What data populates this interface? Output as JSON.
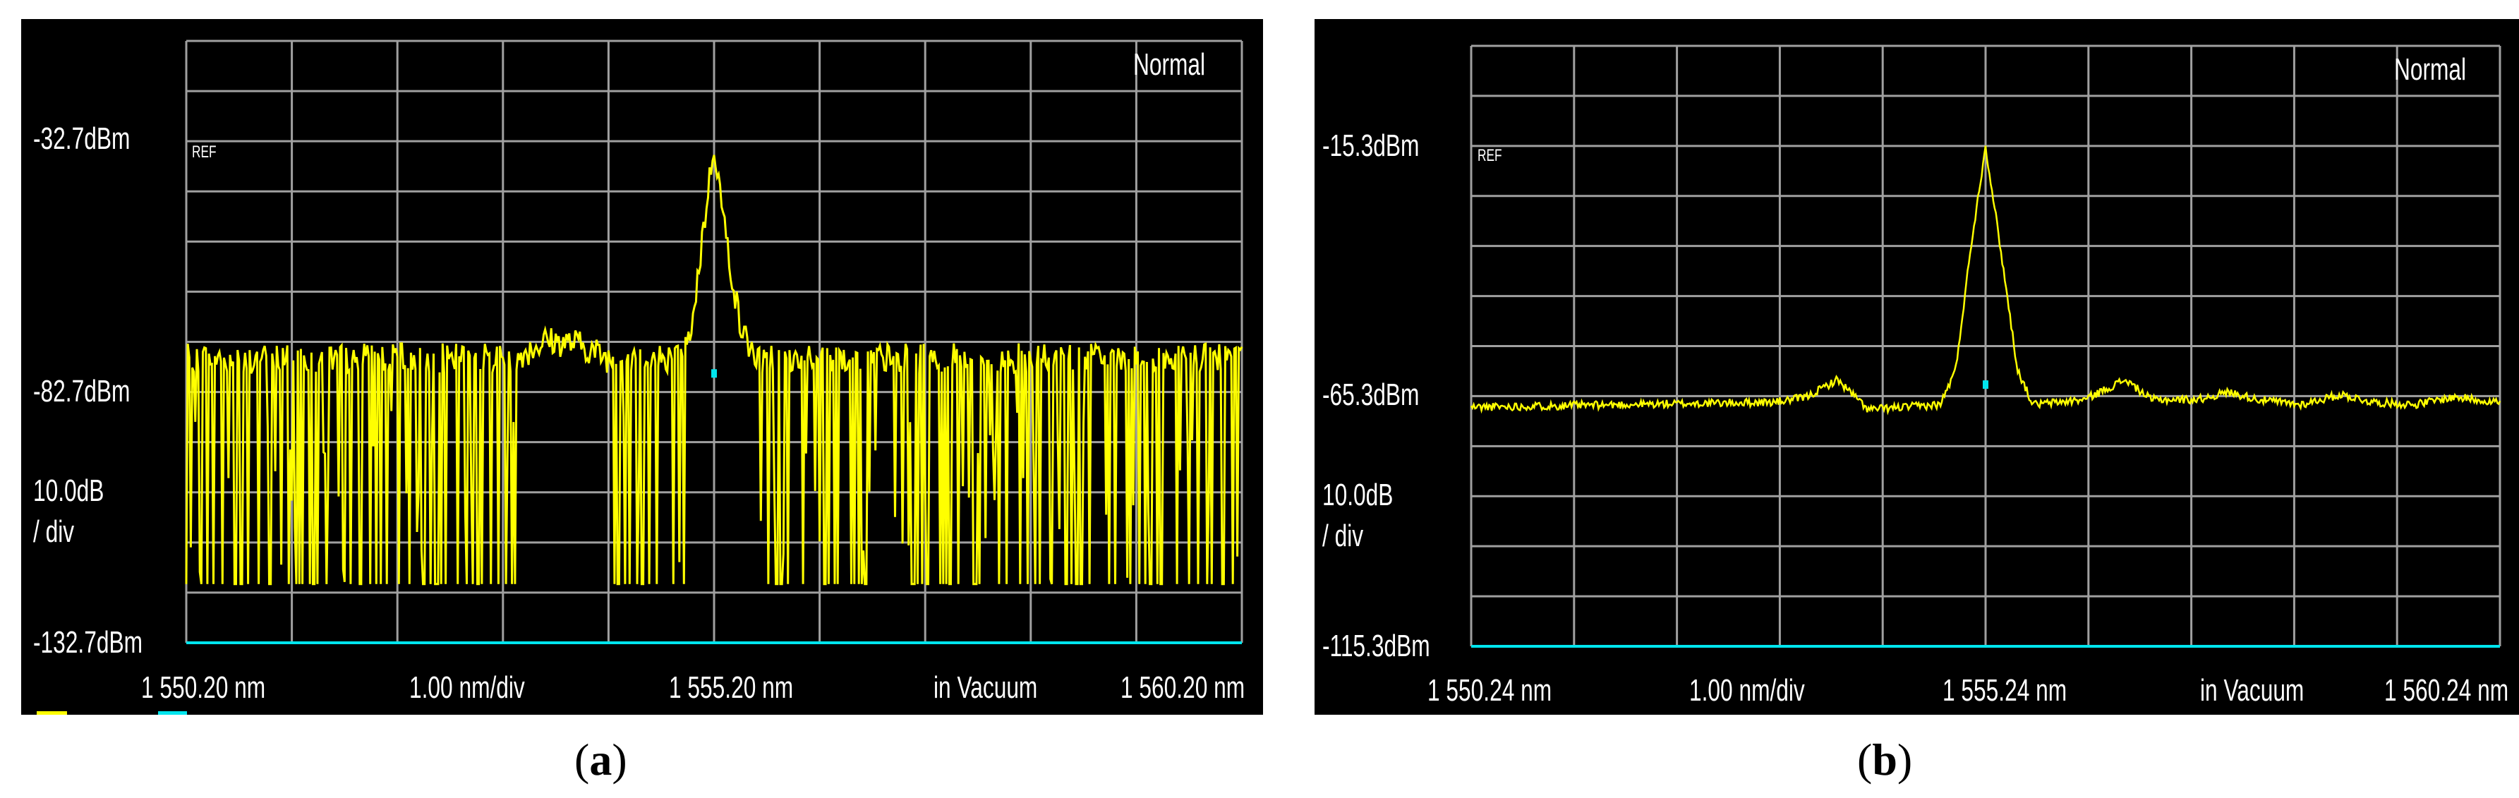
{
  "colors": {
    "trace": "#ffff00",
    "grid": "#a0a0a0",
    "baseline": "#00e5ee",
    "background": "#000000"
  },
  "chart_data": [
    {
      "type": "line",
      "panel": "a",
      "caption": "a",
      "mode": "Normal",
      "ref_marker": "REF",
      "ref_level": "-32.7dBm",
      "mid_level": "-82.7dBm",
      "scale": "10.0dB",
      "scale_unit": "/ div",
      "bottom_level": "-132.7dBm",
      "x_start": "1 550.20 nm",
      "x_div": "1.00 nm/div",
      "x_center": "1 555.20 nm",
      "medium": "in Vacuum",
      "x_end": "1 560.20 nm",
      "xlim": [
        1550.2,
        1560.2
      ],
      "ylim": [
        -132.7,
        -12.7
      ],
      "x_divisions": 10,
      "y_divisions": 12,
      "envelope": [
        [
          1550.2,
          -76
        ],
        [
          1553.3,
          -76
        ],
        [
          1553.6,
          -72.5
        ],
        [
          1553.9,
          -73
        ],
        [
          1554.2,
          -76
        ],
        [
          1554.9,
          -76
        ],
        [
          1555.0,
          -68
        ],
        [
          1555.1,
          -50
        ],
        [
          1555.2,
          -33
        ],
        [
          1555.3,
          -50
        ],
        [
          1555.45,
          -70
        ],
        [
          1555.6,
          -76
        ],
        [
          1560.2,
          -76
        ]
      ],
      "dropout_floor": -121,
      "dropout_regions": [
        [
          1550.2,
          1553.35
        ],
        [
          1554.25,
          1554.95
        ],
        [
          1555.6,
          1560.2
        ]
      ],
      "marker_x": 1555.2,
      "marker_y": -79
    },
    {
      "type": "line",
      "panel": "b",
      "caption": "b",
      "mode": "Normal",
      "ref_marker": "REF",
      "ref_level": "-15.3dBm",
      "mid_level": "-65.3dBm",
      "scale": "10.0dB",
      "scale_unit": "/ div",
      "bottom_level": "-115.3dBm",
      "x_start": "1 550.24 nm",
      "x_div": "1.00 nm/div",
      "x_center": "1 555.24 nm",
      "medium": "in Vacuum",
      "x_end": "1 560.24 nm",
      "xlim": [
        1550.24,
        1560.24
      ],
      "ylim": [
        -115.3,
        4.7
      ],
      "x_divisions": 10,
      "y_divisions": 12,
      "envelope": [
        [
          1550.24,
          -67.5
        ],
        [
          1553.2,
          -66.5
        ],
        [
          1553.5,
          -65.5
        ],
        [
          1553.8,
          -62
        ],
        [
          1554.0,
          -66
        ],
        [
          1554.1,
          -68
        ],
        [
          1554.8,
          -67
        ],
        [
          1554.95,
          -60
        ],
        [
          1555.1,
          -35
        ],
        [
          1555.24,
          -15.3
        ],
        [
          1555.38,
          -35
        ],
        [
          1555.55,
          -60
        ],
        [
          1555.7,
          -67
        ],
        [
          1556.2,
          -66
        ],
        [
          1556.6,
          -62
        ],
        [
          1556.85,
          -66
        ],
        [
          1557.3,
          -66
        ],
        [
          1557.6,
          -64.5
        ],
        [
          1557.9,
          -66
        ],
        [
          1558.3,
          -67
        ],
        [
          1558.7,
          -65
        ],
        [
          1559.0,
          -66.5
        ],
        [
          1559.4,
          -67
        ],
        [
          1559.8,
          -65.5
        ],
        [
          1560.24,
          -66.5
        ]
      ],
      "marker_x": 1555.24,
      "marker_y": -63
    }
  ]
}
